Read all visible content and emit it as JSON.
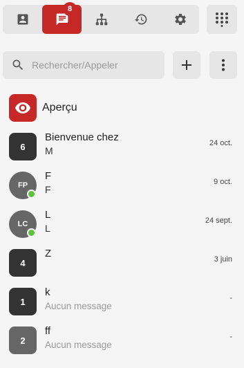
{
  "toolbar": {
    "tabs": [
      {
        "icon": "contact-card-icon"
      },
      {
        "icon": "chat-icon",
        "active": true
      },
      {
        "icon": "org-chart-icon",
        "badge": "8"
      },
      {
        "icon": "history-icon"
      },
      {
        "icon": "gear-icon"
      }
    ],
    "dialpad_icon": "dialpad-icon"
  },
  "search": {
    "placeholder": "Rechercher/Appeler"
  },
  "actions": {
    "add_icon": "plus-icon",
    "more_icon": "more-vertical-icon"
  },
  "preview": {
    "label": "Aperçu",
    "icon": "eye-icon",
    "color": "#c62828"
  },
  "conversations": [
    {
      "avatar": "6",
      "shape": "square",
      "color": "#333333",
      "title": "Bienvenue chez",
      "subtitle": "M",
      "date": "24 oct.",
      "online": false,
      "muted": false
    },
    {
      "avatar": "FP",
      "shape": "round",
      "color": "#666666",
      "title": "F",
      "subtitle": "F",
      "date": "9 oct.",
      "online": true,
      "muted": false
    },
    {
      "avatar": "LC",
      "shape": "round",
      "color": "#666666",
      "title": "L",
      "subtitle": "L",
      "date": "24 sept.",
      "online": true,
      "muted": false
    },
    {
      "avatar": "4",
      "shape": "square",
      "color": "#333333",
      "title": "Z",
      "subtitle": "",
      "date": "3 juin",
      "online": false,
      "muted": false
    },
    {
      "avatar": "1",
      "shape": "square",
      "color": "#333333",
      "title": "k",
      "subtitle": "Aucun message",
      "date": "-",
      "online": false,
      "muted": true
    },
    {
      "avatar": "2",
      "shape": "square",
      "color": "#666666",
      "title": "ff",
      "subtitle": "Aucun message",
      "date": "-",
      "online": false,
      "muted": true
    }
  ],
  "colors": {
    "accent": "#c62828",
    "online": "#5cc33a"
  }
}
